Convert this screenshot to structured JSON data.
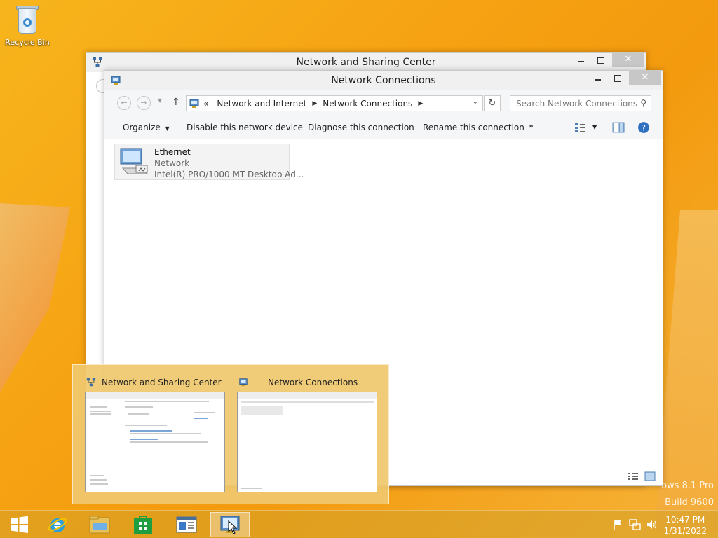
{
  "desktop": {
    "recycle_bin_label": "Recycle Bin",
    "watermark_line1": "ows 8.1 Pro",
    "watermark_line2": "Build 9600"
  },
  "back_window": {
    "title": "Network and Sharing Center"
  },
  "front_window": {
    "title": "Network Connections",
    "nav": {
      "back_icon": "back-arrow-icon",
      "forward_icon": "forward-arrow-icon",
      "up_icon": "up-arrow-icon",
      "breadcrumb_overflow": "«",
      "breadcrumb": [
        "Network and Internet",
        "Network Connections"
      ],
      "search_placeholder": "Search Network Connections"
    },
    "commands": {
      "organize": "Organize",
      "disable": "Disable this network device",
      "diagnose": "Diagnose this connection",
      "rename": "Rename this connection",
      "more": "»"
    },
    "items": [
      {
        "name": "Ethernet",
        "status": "Network",
        "device": "Intel(R) PRO/1000 MT Desktop Ad..."
      }
    ]
  },
  "thumbnails": [
    {
      "title": "Network and Sharing Center"
    },
    {
      "title": "Network Connections"
    }
  ],
  "taskbar": {
    "clock_time": "10:47 PM",
    "clock_date": "1/31/2022"
  },
  "colors": {
    "accent": "#f6a313",
    "link_blue": "#3a8ad1"
  }
}
